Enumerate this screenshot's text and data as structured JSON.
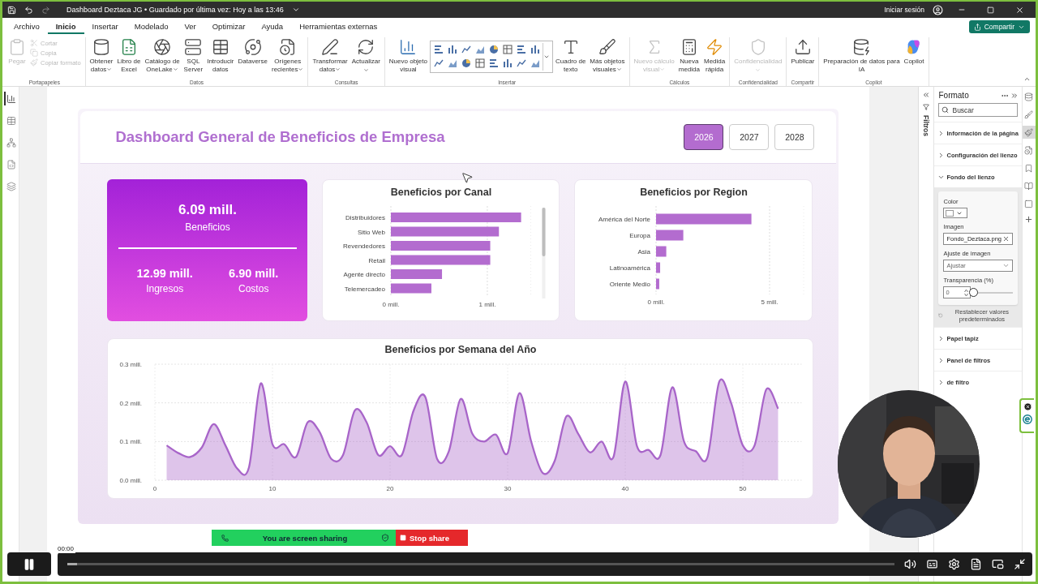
{
  "title_bar": {
    "title": "Dashboard Deztaca JG • Guardado por última vez: Hoy a las 13:46",
    "user_label": "Iniciar sesión"
  },
  "menu_tabs": [
    {
      "label": "Archivo",
      "selected": false
    },
    {
      "label": "Inicio",
      "selected": true
    },
    {
      "label": "Insertar",
      "selected": false
    },
    {
      "label": "Modelado",
      "selected": false
    },
    {
      "label": "Ver",
      "selected": false
    },
    {
      "label": "Optimizar",
      "selected": false
    },
    {
      "label": "Ayuda",
      "selected": false
    },
    {
      "label": "Herramientas externas",
      "selected": false
    }
  ],
  "share_button": "Compartir",
  "ribbon": [
    {
      "group": "Portapapeles",
      "items": [
        {
          "kind": "large",
          "label": "Pegar",
          "disabled": true,
          "dropdown": false
        },
        {
          "kind": "small",
          "label": "Cortar",
          "disabled": true,
          "dropdown": false
        },
        {
          "kind": "small",
          "label": "Copia",
          "disabled": true,
          "dropdown": false
        },
        {
          "kind": "small",
          "label": "Copiar formato",
          "disabled": true,
          "dropdown": false
        }
      ]
    },
    {
      "group": "Datos",
      "items": [
        {
          "kind": "large",
          "label": "Obtener\ndatos",
          "disabled": false,
          "dropdown": true
        },
        {
          "kind": "large",
          "label": "Libro de\nExcel",
          "disabled": false,
          "dropdown": false
        },
        {
          "kind": "large",
          "label": "Catálogo de\nOneLake",
          "disabled": false,
          "dropdown": true
        },
        {
          "kind": "large",
          "label": "SQL\nServer",
          "disabled": false,
          "dropdown": false
        },
        {
          "kind": "large",
          "label": "Introducir\ndatos",
          "disabled": false,
          "dropdown": false
        },
        {
          "kind": "large",
          "label": "Dataverse",
          "disabled": false,
          "dropdown": false
        },
        {
          "kind": "large",
          "label": "Orígenes\nrecientes",
          "disabled": false,
          "dropdown": true
        }
      ]
    },
    {
      "group": "Consultas",
      "items": [
        {
          "kind": "large",
          "label": "Transformar\ndatos",
          "disabled": false,
          "dropdown": true
        },
        {
          "kind": "large",
          "label": "Actualizar",
          "disabled": false,
          "dropdown": true
        }
      ]
    },
    {
      "group": "Insertar",
      "items": [
        {
          "kind": "large",
          "label": "Nuevo objeto\nvisual",
          "disabled": false,
          "dropdown": false
        },
        {
          "kind": "gallery"
        },
        {
          "kind": "large",
          "label": "Cuadro de\ntexto",
          "disabled": false,
          "dropdown": false
        },
        {
          "kind": "large",
          "label": "Más objetos\nvisuales",
          "disabled": false,
          "dropdown": true
        }
      ]
    },
    {
      "group": "Cálculos",
      "items": [
        {
          "kind": "large",
          "label": "Nuevo cálculo\nvisual",
          "disabled": true,
          "dropdown": true
        },
        {
          "kind": "large",
          "label": "Nueva\nmedida",
          "disabled": false,
          "dropdown": false
        },
        {
          "kind": "large",
          "label": "Medida\nrápida",
          "disabled": false,
          "dropdown": false
        }
      ]
    },
    {
      "group": "Confidencialidad",
      "items": [
        {
          "kind": "large",
          "label": "Confidencialidad",
          "disabled": true,
          "dropdown": true
        }
      ]
    },
    {
      "group": "Compartir",
      "items": [
        {
          "kind": "large",
          "label": "Publicar",
          "disabled": false,
          "dropdown": false
        }
      ]
    },
    {
      "group": "Copilot",
      "items": [
        {
          "kind": "large",
          "label": "Preparación de datos para\nIA",
          "disabled": false,
          "dropdown": false
        },
        {
          "kind": "large",
          "label": "Copilot",
          "disabled": false,
          "dropdown": false
        }
      ]
    }
  ],
  "left_rail": [
    {
      "selected": true
    },
    {
      "selected": false
    },
    {
      "selected": false
    },
    {
      "selected": false
    },
    {
      "selected": false
    }
  ],
  "report": {
    "title": "Dashboard General de Beneficios de Empresa",
    "years": [
      {
        "label": "2026",
        "selected": true
      },
      {
        "label": "2027",
        "selected": false
      },
      {
        "label": "2028",
        "selected": false
      }
    ],
    "kpi": {
      "main": {
        "value": "6.09 mill.",
        "label": "Beneficios"
      },
      "sub": [
        {
          "value": "12.99 mill.",
          "label": "Ingresos"
        },
        {
          "value": "6.90 mill.",
          "label": "Costos"
        }
      ]
    },
    "canal_chart": {
      "chart_data": {
        "type": "bar",
        "orientation": "horizontal",
        "title": "Beneficios por Canal",
        "categories": [
          "Distribuidores",
          "Sitio Web",
          "Revendedores",
          "Retail",
          "Agente directo",
          "Telemercadeo"
        ],
        "series": [
          {
            "color": "#b36ccf",
            "values": [
              1.35,
              1.12,
              1.03,
              1.03,
              0.53,
              0.42
            ]
          }
        ],
        "xlim": [
          0,
          1.45
        ],
        "xticks": [
          {
            "value": 0,
            "label": "0 mill."
          },
          {
            "value": 1,
            "label": "1 mill."
          }
        ]
      }
    },
    "region_chart": {
      "chart_data": {
        "type": "bar",
        "orientation": "horizontal",
        "title": "Beneficios por Region",
        "categories": [
          "América del Norte",
          "Europa",
          "Asia",
          "Latinoamérica",
          "Oriente Medio"
        ],
        "series": [
          {
            "color": "#b36ccf",
            "values": [
              4.2,
              1.2,
              0.45,
              0.18,
              0.14
            ]
          }
        ],
        "xlim": [
          0,
          6.5
        ],
        "xticks": [
          {
            "value": 0,
            "label": "0 mill."
          },
          {
            "value": 5,
            "label": "5 mill."
          }
        ]
      }
    },
    "week_chart": {
      "chart_data": {
        "type": "area",
        "title": "Beneficios por Semana del Año",
        "x": [
          1,
          2,
          3,
          4,
          5,
          6,
          7,
          8,
          9,
          10,
          11,
          12,
          13,
          14,
          15,
          16,
          17,
          18,
          19,
          20,
          21,
          22,
          23,
          24,
          25,
          26,
          27,
          28,
          29,
          30,
          31,
          32,
          33,
          34,
          35,
          36,
          37,
          38,
          39,
          40,
          41,
          42,
          43,
          44,
          45,
          46,
          47,
          48,
          49,
          50,
          51,
          52,
          53
        ],
        "series": [
          {
            "color": "#a865c9",
            "values": [
              0.09,
              0.07,
              0.06,
              0.085,
              0.145,
              0.09,
              0.03,
              0.033,
              0.25,
              0.093,
              0.093,
              0.06,
              0.15,
              0.125,
              0.055,
              0.065,
              0.18,
              0.15,
              0.065,
              0.088,
              0.065,
              0.18,
              0.215,
              0.055,
              0.075,
              0.21,
              0.12,
              0.1,
              0.118,
              0.07,
              0.225,
              0.1,
              0.018,
              0.05,
              0.165,
              0.12,
              0.072,
              0.1,
              0.06,
              0.255,
              0.088,
              0.078,
              0.065,
              0.24,
              0.1,
              0.075,
              0.06,
              0.255,
              0.2,
              0.09,
              0.09,
              0.235,
              0.185
            ]
          }
        ],
        "grid": true,
        "xlim": [
          0,
          55
        ],
        "ylim": [
          0,
          0.3
        ],
        "xticks": [
          0,
          10,
          20,
          30,
          40,
          50
        ],
        "yticks": [
          {
            "value": 0,
            "label": "0.0 mill."
          },
          {
            "value": 0.1,
            "label": "0.1 mill."
          },
          {
            "value": 0.2,
            "label": "0.2 mill."
          },
          {
            "value": 0.3,
            "label": "0.3 mill."
          }
        ]
      }
    }
  },
  "filters_label": "Filtros",
  "format_pane": {
    "title": "Formato",
    "search_placeholder": "Buscar",
    "sections": [
      {
        "label": "Información de la página",
        "expanded": false
      },
      {
        "label": "Configuración del lienzo",
        "expanded": false
      },
      {
        "label": "Fondo del lienzo",
        "expanded": true,
        "reset": "Restablecer valores predeterminados",
        "fields": [
          {
            "kind": "color",
            "label": "Color"
          },
          {
            "kind": "file",
            "label": "Imagen",
            "value": "Fondo_Deztaca.png"
          },
          {
            "kind": "select",
            "label": "Ajuste de imagen",
            "value": "Ajustar"
          },
          {
            "kind": "slider",
            "label": "Transparencia (%)",
            "value": "0",
            "level": 0
          }
        ]
      },
      {
        "label": "Papel tapiz",
        "expanded": false
      },
      {
        "label": "Panel de filtros",
        "expanded": false
      },
      {
        "label": "de filtro",
        "expanded": false
      }
    ]
  },
  "pane_rail": [
    {
      "selected": false
    },
    {
      "selected": false
    },
    {
      "selected": true
    },
    {
      "selected": false
    },
    {
      "selected": false
    },
    {
      "selected": false
    },
    {
      "selected": false
    }
  ],
  "screen_share": {
    "status": "You are screen sharing",
    "stop": "Stop share"
  },
  "video_player": {
    "time": "00:00",
    "progress": {
      "level": 0.012
    }
  }
}
